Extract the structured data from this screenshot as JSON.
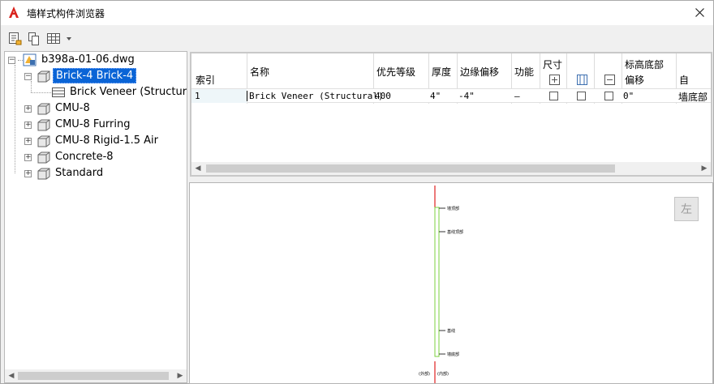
{
  "window": {
    "title": "墙样式构件浏览器",
    "app_icon": "autocad-a-icon",
    "close_icon": "close-icon"
  },
  "toolbar": {
    "buttons": [
      {
        "icon": "properties-list-icon"
      },
      {
        "icon": "copy-icon"
      },
      {
        "icon": "table-view-dropdown-icon"
      }
    ]
  },
  "tree": {
    "root": {
      "label": "b398a-01-06.dwg",
      "icon": "drawing-file-icon"
    },
    "items": [
      {
        "label": "Brick-4 Brick-4",
        "selected": true,
        "expanded": true,
        "children": [
          {
            "label": "Brick Veneer (Structural)",
            "icon": "wall-component-icon"
          }
        ]
      },
      {
        "label": "CMU-8"
      },
      {
        "label": "CMU-8 Furring"
      },
      {
        "label": "CMU-8 Rigid-1.5 Air"
      },
      {
        "label": "Concrete-8"
      },
      {
        "label": "Standard"
      }
    ]
  },
  "grid": {
    "headers": {
      "index": "索引",
      "name": "名称",
      "priority": "优先等级",
      "thickness": "厚度",
      "edge_offset": "边缘偏移",
      "function": "功能",
      "dimension": "尺寸",
      "base_elevation": "标高底部",
      "base_offset": "偏移",
      "auto": "自"
    },
    "rows": [
      {
        "index": "1",
        "name": "Brick Veneer (Structural)",
        "priority": "400",
        "thickness": "4\"",
        "edge_offset": "-4\"",
        "function": "—",
        "dim_checks": [
          false,
          false,
          false
        ],
        "base_offset": "0\"",
        "base_from": "墙底部"
      }
    ]
  },
  "preview": {
    "side_button": "左",
    "labels": {
      "top": "墙顶部",
      "upper": "基线顶部",
      "lower": "基线",
      "bottom": "墙底部",
      "left_bottom": "(外部)",
      "right_bottom": "(内部)"
    },
    "colors": {
      "wall_line": "#7bd23c",
      "marker": "#e02020"
    }
  }
}
